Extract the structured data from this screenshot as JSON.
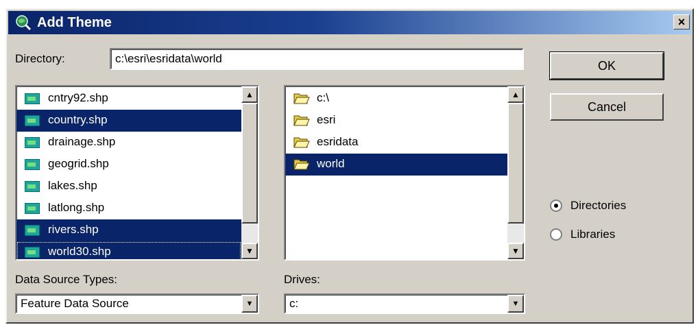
{
  "window": {
    "title": "Add Theme",
    "close_glyph": "×"
  },
  "directory": {
    "label": "Directory:",
    "value": "c:\\esri\\esridata\\world"
  },
  "files": [
    {
      "name": "cntry92.shp",
      "selected": false
    },
    {
      "name": "country.shp",
      "selected": true
    },
    {
      "name": "drainage.shp",
      "selected": false
    },
    {
      "name": "geogrid.shp",
      "selected": false
    },
    {
      "name": "lakes.shp",
      "selected": false
    },
    {
      "name": "latlong.shp",
      "selected": false
    },
    {
      "name": "rivers.shp",
      "selected": true
    },
    {
      "name": "world30.shp",
      "selected": true
    }
  ],
  "folders": [
    {
      "name": "c:\\",
      "selected": false,
      "open": true
    },
    {
      "name": "esri",
      "selected": false,
      "open": true
    },
    {
      "name": "esridata",
      "selected": false,
      "open": true
    },
    {
      "name": "world",
      "selected": true,
      "open": true
    }
  ],
  "buttons": {
    "ok": "OK",
    "cancel": "Cancel"
  },
  "options": {
    "directories": "Directories",
    "libraries": "Libraries",
    "selected": "directories"
  },
  "data_source_types": {
    "label": "Data Source Types:",
    "value": "Feature Data Source"
  },
  "drives": {
    "label": "Drives:",
    "value": "c:"
  },
  "glyphs": {
    "up": "▲",
    "down": "▼"
  },
  "colors": {
    "selection": "#0a246a",
    "dialog": "#d4d0c8",
    "titlebar": "#0a246a"
  }
}
